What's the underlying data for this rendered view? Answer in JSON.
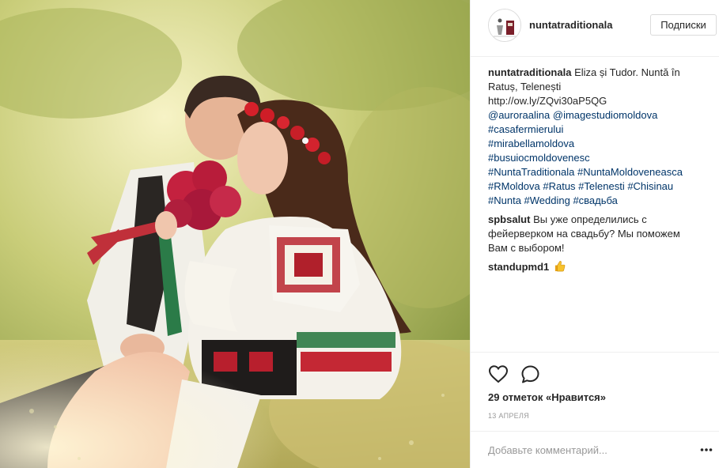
{
  "post": {
    "photo_alt": "photo-wedding-couple-traditional-costume"
  },
  "header": {
    "username": "nuntatraditionala",
    "follow_label": "Подписки"
  },
  "caption": {
    "username": "nuntatraditionala",
    "text": "Eliza și Tudor. Nuntă în Ratuș, Telenești",
    "url": "http://ow.ly/ZQvi30aP5QG",
    "mentions": [
      "@auroraalina",
      "@imagestudiomoldova"
    ],
    "hashtags_lines": [
      "#casafermierului",
      "#mirabellamoldova",
      "#busuiocmoldovenesc",
      "#NuntaTraditionala #NuntaMoldoveneasca",
      "#RMoldova #Ratus #Telenesti #Chisinau",
      "#Nunta #Wedding #свадьба"
    ]
  },
  "comments": [
    {
      "username": "spbsalut",
      "text": "Вы уже определились с фейерверком на свадьбу? Мы поможем Вам с выбором!"
    },
    {
      "username": "standupmd1",
      "text": "",
      "emoji": "thumbs-up"
    }
  ],
  "actions": {
    "heart_icon": "heart-icon",
    "comment_icon": "comment-icon",
    "likes_text": "29 отметок «Нравится»",
    "date_text": "13 апреля"
  },
  "add_comment": {
    "placeholder": "Добавьте комментарий...",
    "more_icon": "ellipsis-icon"
  },
  "colors": {
    "link": "#003569",
    "text": "#262626",
    "muted": "#999999",
    "border": "#efefef"
  }
}
